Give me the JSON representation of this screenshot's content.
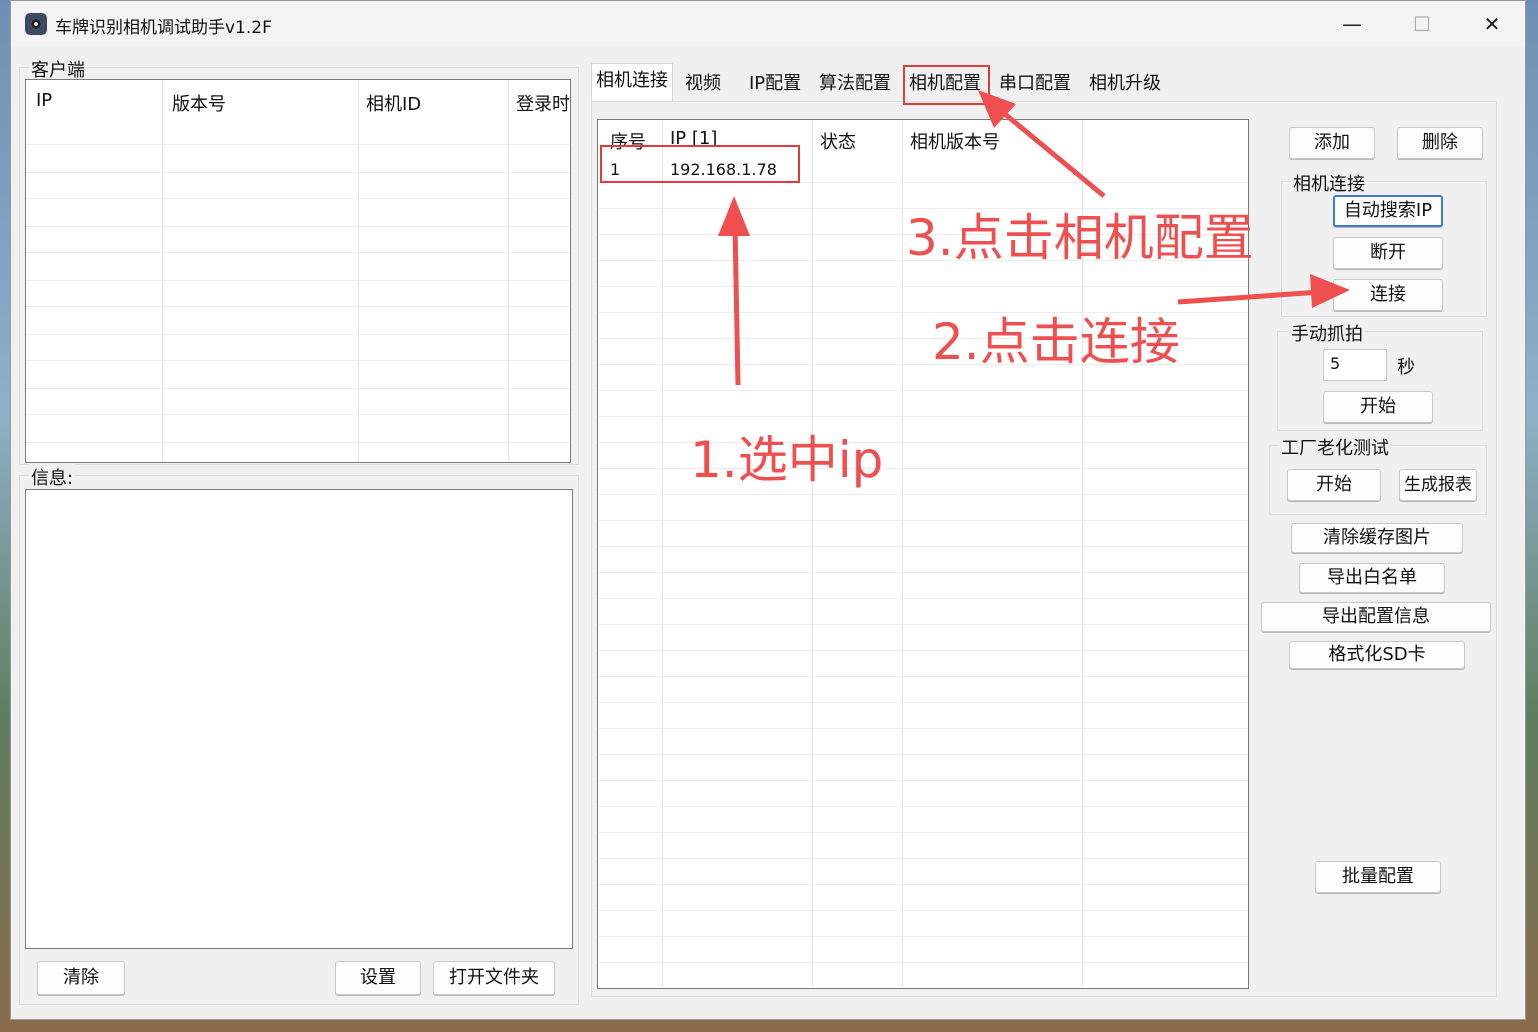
{
  "window": {
    "title": "车牌识别相机调试助手v1.2F"
  },
  "client": {
    "group_label": "客户端",
    "columns": [
      "IP",
      "版本号",
      "相机ID",
      "登录时"
    ]
  },
  "info": {
    "group_label": "信息:",
    "clear_button": "清除",
    "settings_button": "设置",
    "open_folder_button": "打开文件夹"
  },
  "tabs": [
    "相机连接",
    "视频",
    "IP配置",
    "算法配置",
    "相机配置",
    "串口配置",
    "相机升级"
  ],
  "camera_list": {
    "columns": [
      "序号",
      "IP [1]",
      "状态",
      "相机版本号"
    ],
    "rows": [
      {
        "index": "1",
        "ip": "192.168.1.78",
        "status": "",
        "version": ""
      }
    ]
  },
  "side": {
    "add_button": "添加",
    "delete_button": "删除",
    "conn_group_label": "相机连接",
    "auto_search_button": "自动搜索IP",
    "disconnect_button": "断开",
    "connect_button": "连接",
    "manual_group_label": "手动抓拍",
    "interval_value": "5",
    "interval_unit": "秒",
    "manual_start_button": "开始",
    "aging_group_label": "工厂老化测试",
    "aging_start_button": "开始",
    "report_button": "生成报表",
    "clear_cache_button": "清除缓存图片",
    "export_whitelist_button": "导出白名单",
    "export_config_button": "导出配置信息",
    "format_sd_button": "格式化SD卡",
    "batch_config_button": "批量配置"
  },
  "annotations": {
    "step1": "1.选中ip",
    "step2": "2.点击连接",
    "step3": "3.点击相机配置",
    "color": "#ef4f4f"
  }
}
